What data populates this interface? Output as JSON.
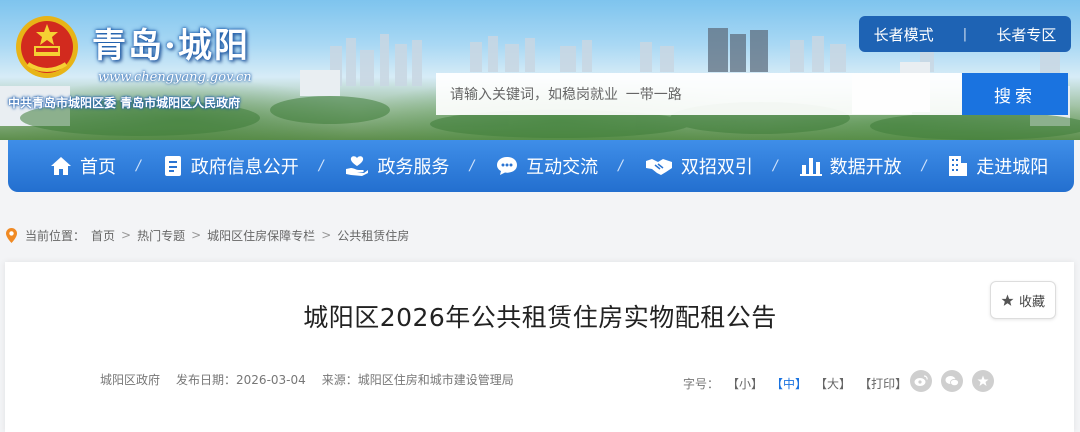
{
  "header": {
    "site_name": "青岛·城阳",
    "site_url": "www.chengyang.gov.cn",
    "subtitle": "中共青岛市城阳区委  青岛市城阳区人民政府",
    "elder_mode": "长者模式",
    "elder_zone": "长者专区",
    "search_placeholder": "请输入关键词，如稳岗就业  一带一路",
    "search_button": "搜索"
  },
  "nav": {
    "items": [
      {
        "label": "首页",
        "icon": "home-icon"
      },
      {
        "label": "政府信息公开",
        "icon": "document-icon"
      },
      {
        "label": "政务服务",
        "icon": "hand-heart-icon"
      },
      {
        "label": "互动交流",
        "icon": "chat-icon"
      },
      {
        "label": "双招双引",
        "icon": "handshake-icon"
      },
      {
        "label": "数据开放",
        "icon": "bar-chart-icon"
      },
      {
        "label": "走进城阳",
        "icon": "building-icon"
      }
    ],
    "separator": "/"
  },
  "breadcrumb": {
    "prefix": "当前位置：",
    "items": [
      "首页",
      "热门专题",
      "城阳区住房保障专栏",
      "公共租赁住房"
    ],
    "arrow": ">"
  },
  "article": {
    "favorite": "收藏",
    "title": "城阳区2026年公共租赁住房实物配租公告",
    "author": "城阳区政府",
    "date_label": "发布日期：",
    "date": "2026-03-04",
    "source_label": "来源：",
    "source": "城阳区住房和城市建设管理局",
    "fontsize_label": "字号：",
    "fontsize_small": "【小】",
    "fontsize_medium": "【中】",
    "fontsize_large": "【大】",
    "print": "【打印】"
  },
  "colors": {
    "primary_blue": "#236fcf",
    "search_button": "#1a73e0",
    "mode_box": "#1e63b4"
  }
}
